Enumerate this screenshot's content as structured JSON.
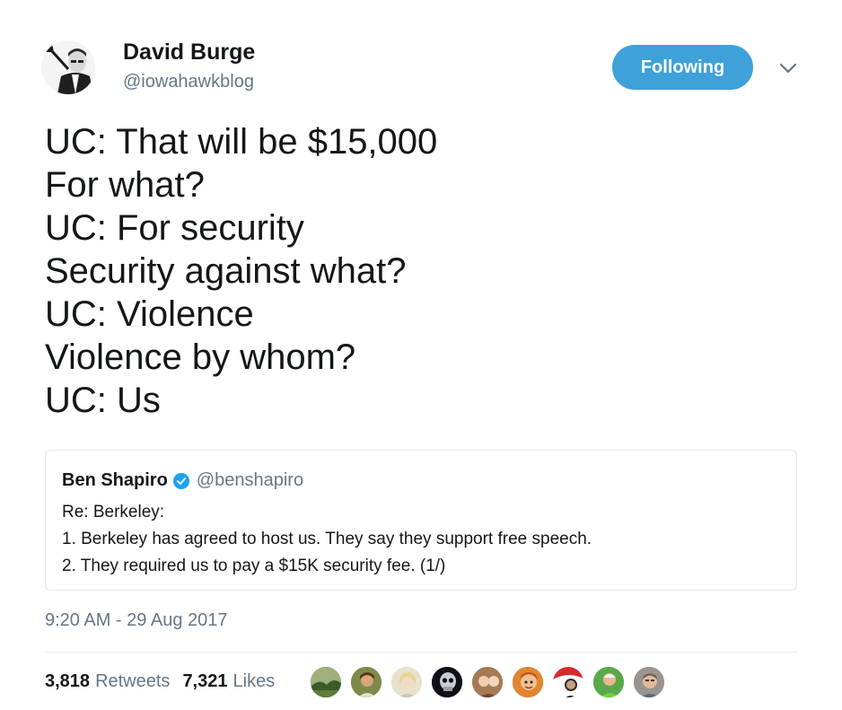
{
  "author": {
    "display_name": "David Burge",
    "handle": "@iowahawkblog"
  },
  "follow_button": {
    "label": "Following",
    "color": "#3ea1d9"
  },
  "tweet": {
    "lines": [
      "UC: That will be $15,000",
      "For what?",
      "UC: For security",
      "Security against what?",
      "UC: Violence",
      "Violence by whom?",
      "UC: Us"
    ],
    "timestamp": "9:20 AM - 29 Aug 2017"
  },
  "quoted_tweet": {
    "display_name": "Ben Shapiro",
    "handle": "@benshapiro",
    "verified": true,
    "lines": [
      "Re: Berkeley:",
      "1. Berkeley has agreed to host us. They say they support free speech.",
      "2. They required us to pay a $15K security fee. (1/)"
    ]
  },
  "stats": {
    "retweets_count": "3,818",
    "retweets_label": "Retweets",
    "likes_count": "7,321",
    "likes_label": "Likes"
  },
  "liker_avatars": [
    {
      "icon": "landscape-avatar",
      "color": "#4f6a3a"
    },
    {
      "icon": "person-avatar",
      "color": "#6b7a3a"
    },
    {
      "icon": "person-avatar",
      "color": "#d8d2c0"
    },
    {
      "icon": "skull-avatar",
      "color": "#101418"
    },
    {
      "icon": "person-avatar",
      "color": "#b98a62"
    },
    {
      "icon": "cartoon-avatar",
      "color": "#c0551e"
    },
    {
      "icon": "person-avatar",
      "color": "#d62a2a"
    },
    {
      "icon": "person-avatar",
      "color": "#4a9a3a"
    },
    {
      "icon": "person-avatar",
      "color": "#8a8480"
    }
  ]
}
